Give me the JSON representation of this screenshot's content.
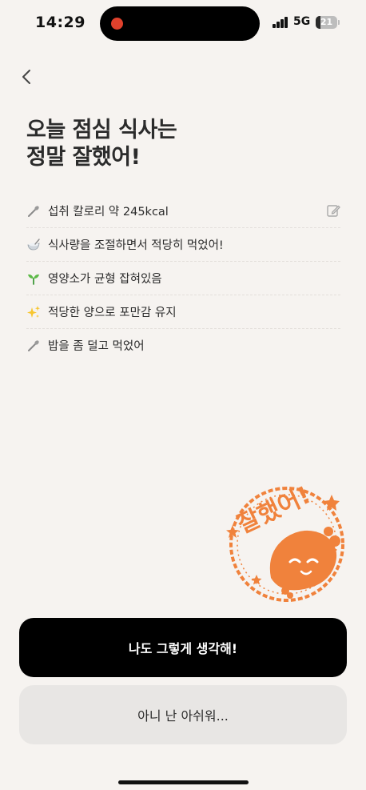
{
  "status_bar": {
    "time": "14:29",
    "network": "5G",
    "battery": "21",
    "battery_level": 0.21
  },
  "title": {
    "line1": "오늘 점심 식사는",
    "line2": "정말 잘했어!"
  },
  "feedback": [
    {
      "icon": "spoon-icon",
      "text": "섭취 칼로리 약 245kcal"
    },
    {
      "icon": "bowl-icon",
      "text": "식사량을 조절하면서 적당히 먹었어!"
    },
    {
      "icon": "sprout-icon",
      "text": "영양소가 균형 잡혀있음"
    },
    {
      "icon": "sparkles-icon",
      "text": "적당한 양으로 포만감 유지"
    },
    {
      "icon": "spoon-icon",
      "text": "밥을 좀 덜고 먹었어"
    }
  ],
  "stamp": {
    "text": "잘했어!",
    "color": "#f0823c"
  },
  "buttons": {
    "primary": "나도 그렇게 생각해!",
    "secondary": "아니 난 아쉬워..."
  },
  "colors": {
    "background": "#f6f3f0",
    "primary_button": "#000000",
    "secondary_button": "#e8e6e4",
    "accent": "#f0823c"
  }
}
